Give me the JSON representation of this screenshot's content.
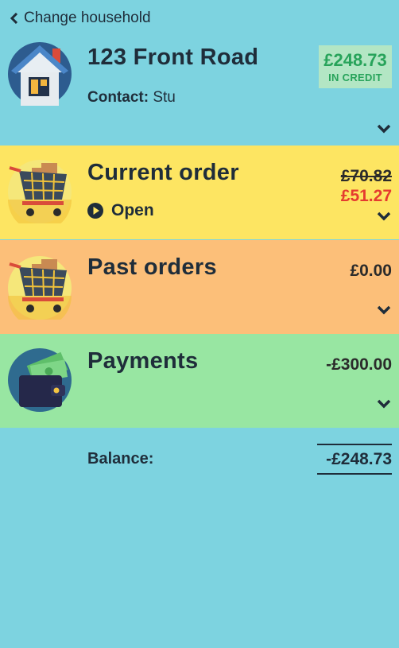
{
  "nav": {
    "back_label": "Change household"
  },
  "household": {
    "address": "123 Front Road",
    "contact_label": "Contact:",
    "contact_name": "Stu",
    "credit_amount": "£248.73",
    "credit_label": "IN CREDIT"
  },
  "current_order": {
    "title": "Current order",
    "status": "Open",
    "original_price": "£70.82",
    "discounted_price": "£51.27",
    "background": "#fde562"
  },
  "past_orders": {
    "title": "Past orders",
    "amount": "£0.00",
    "background": "#fcbf79"
  },
  "payments": {
    "title": "Payments",
    "amount": "-£300.00",
    "background": "#98e6a2"
  },
  "balance": {
    "label": "Balance:",
    "amount": "-£248.73"
  },
  "colors": {
    "page_background": "#7dd3e0",
    "credit_green": "#27a35a",
    "discount_red": "#e53b2f"
  }
}
